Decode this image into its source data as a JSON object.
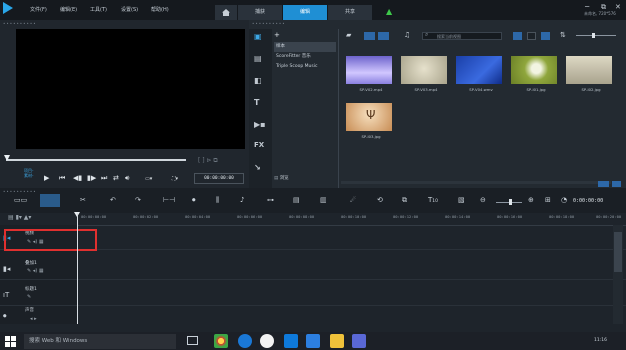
{
  "menu": [
    "文件(F)",
    "编辑(E)",
    "工具(T)",
    "设置(S)",
    "帮助(H)"
  ],
  "tabs": [
    {
      "label": "捕获"
    },
    {
      "label": "编辑"
    },
    {
      "label": "共享"
    }
  ],
  "window": {
    "size_info": "未命名, 720*576",
    "min": "─",
    "restore": "⧉",
    "close": "✕"
  },
  "player": {
    "mode_line1": "项目-",
    "mode_line2": "素材-",
    "timecode": "00:00:00:00"
  },
  "library": {
    "add_label": "+",
    "categories": [
      "样本",
      "ScoreFitter 音乐",
      "Triple Scoop Music"
    ],
    "browse_label": "浏览",
    "search_placeholder": "搜索当前视图",
    "thumbnails": [
      {
        "label": "SP-V02.mp4",
        "color": "#7d74d8",
        "color2": "#c1b6ff"
      },
      {
        "label": "SP-V03.mp4",
        "color": "#c7c2a8",
        "color2": "#e6e1cc"
      },
      {
        "label": "SP-V04.wmv",
        "color": "#1846b8",
        "color2": "#3d6be0"
      },
      {
        "label": "SP-I01.jpg",
        "color": "#9ab04a",
        "color2": "#e6ecd0"
      },
      {
        "label": "SP-I02.jpg",
        "color": "#b9b39e",
        "color2": "#e2ddca"
      },
      {
        "label": "SP-I03.jpg",
        "color": "#c78f56",
        "color2": "#f1d7b5"
      }
    ]
  },
  "timeline": {
    "timecode": "0:00:00:00",
    "ruler": [
      "00:00:00:00",
      "00:00:02:00",
      "00:00:04:00",
      "00:00:06:00",
      "00:00:08:00",
      "00:00:10:00",
      "00:00:12:00",
      "00:00:14:00",
      "00:00:16:00",
      "00:00:18:00",
      "00:00:20:00"
    ],
    "tracks": [
      {
        "name": "视频"
      },
      {
        "name": "叠加1"
      },
      {
        "name": "标题1"
      },
      {
        "name": "声音"
      }
    ]
  },
  "taskbar": {
    "search_text": "搜索 Web 和 Windows",
    "time": "11:16"
  },
  "colors": {
    "accent": "#1f8fd4",
    "highlight": "#e0302f",
    "upload": "#3ec84a"
  }
}
